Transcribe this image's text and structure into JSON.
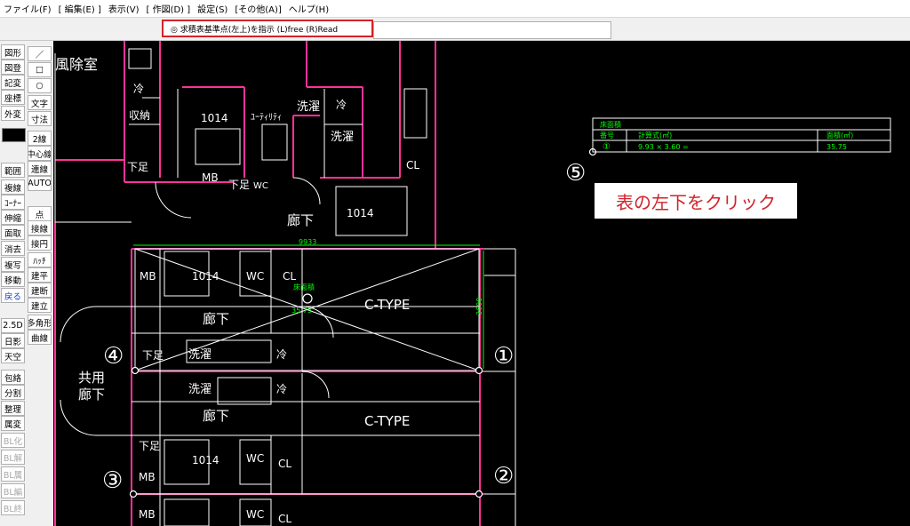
{
  "menu": [
    "ファイル(F)",
    "[ 編集(E) ]",
    "表示(V)",
    "[ 作図(D) ]",
    "設定(S)",
    "[その他(A)]",
    "ヘルプ(H)"
  ],
  "prompt": "◎ 求積表基準点(左上)を指示 (L)free (R)Read",
  "toolbar_left": [
    "図形",
    "図登",
    "記変",
    "座標",
    "外変",
    "範囲",
    "複線",
    "ｺｰﾅｰ",
    "伸縮",
    "面取",
    "消去",
    "複写",
    "移動",
    "戻る",
    "2.5D",
    "日影",
    "天空",
    "包絡",
    "分割",
    "整理",
    "属変",
    "BL化",
    "BL解",
    "BL属",
    "BL編",
    "BL終"
  ],
  "toolbar_right": [
    "／",
    "□",
    "○",
    "文字",
    "寸法",
    "2線",
    "中心線",
    "連線",
    "AUTO",
    "点",
    "接線",
    "接円",
    "ﾊｯﾁ",
    "建平",
    "建断",
    "建立",
    "多角形",
    "曲線"
  ],
  "table": {
    "title": "床面積",
    "headers": [
      "番号",
      "計算式(㎡)",
      "面積(㎡)"
    ],
    "row": {
      "no": "①",
      "formula": "9.93 × 3.60 =",
      "area": "35.75"
    }
  },
  "instruction": "表の左下をクリック",
  "callouts": [
    "①",
    "②",
    "③",
    "④",
    "⑤"
  ],
  "rooms": {
    "wind_room": "風除室",
    "cool": "冷",
    "storage": "収納",
    "unit": "1014",
    "utility": "ﾕｰﾃｨﾘﾃｨ",
    "laundry": "洗濯",
    "wc": "WC",
    "cl": "CL",
    "mb": "MB",
    "footwell": "下足",
    "corridor": "廊下",
    "shared_1": "共用",
    "shared_2": "廊下",
    "ctype": "C-TYPE",
    "floor_area": "床面積",
    "floor_value": "35.75",
    "dim_w": "9933",
    "dim_h": "3600"
  },
  "colors": {
    "cad_background": "#000000",
    "wall_line": "#ff3399",
    "green": "#00ff00",
    "highlight": "#d2232a"
  }
}
